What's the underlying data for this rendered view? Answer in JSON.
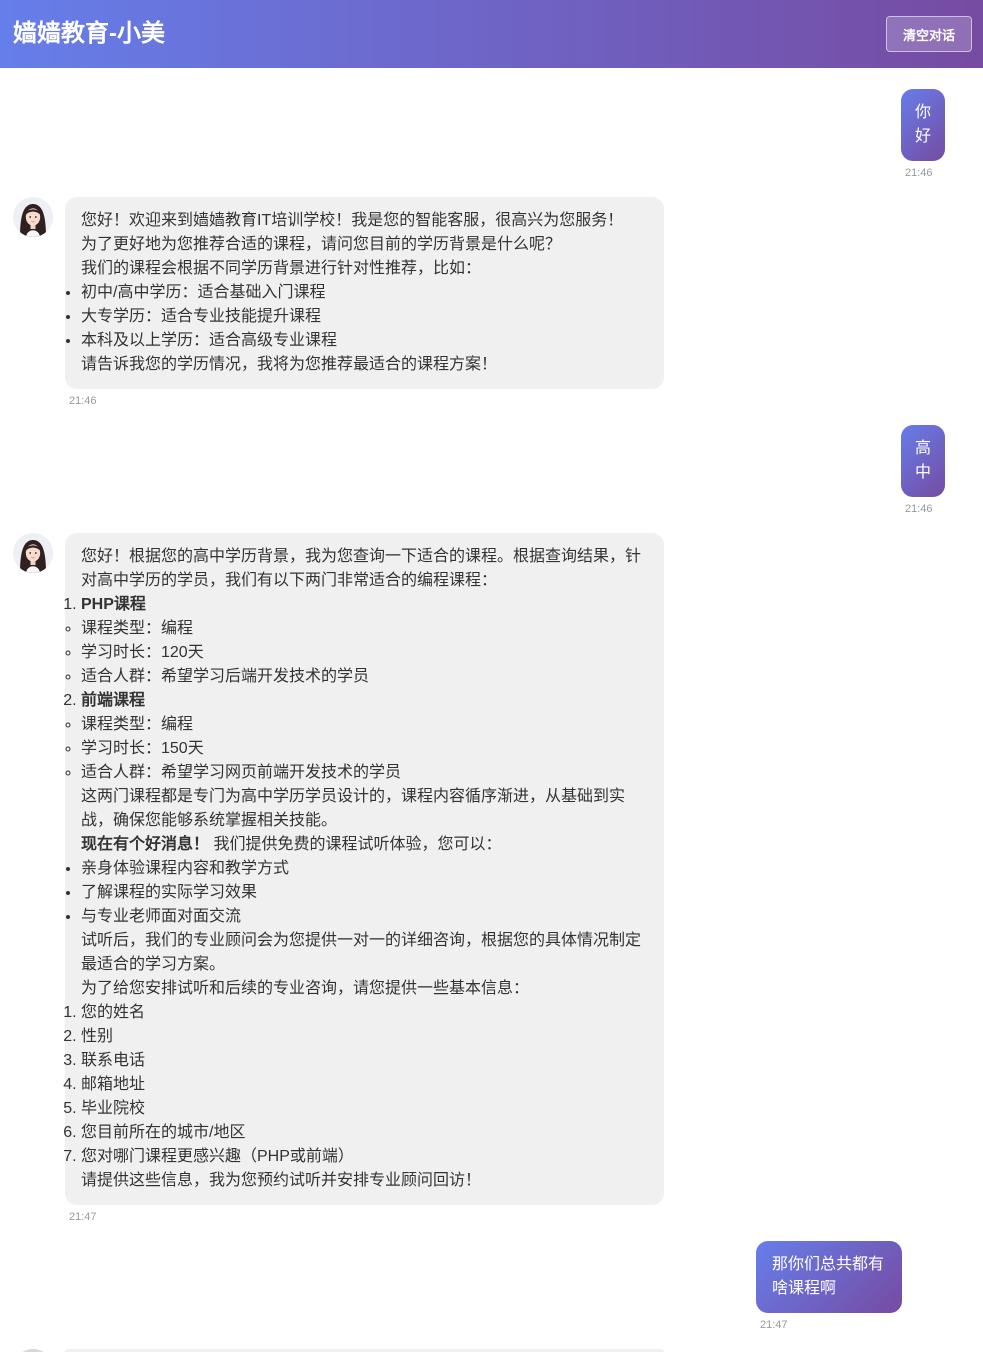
{
  "app": {
    "title": "嫱嫱教育-小美",
    "clear_label": "清空对话"
  },
  "colors": {
    "header_gradient_start": "#667eea",
    "header_gradient_end": "#764ba2",
    "user_bubble_gradient_start": "#667eea",
    "user_bubble_gradient_end": "#764ba2",
    "assistant_bubble": "#f0f0f0",
    "assistant_text": "#333333",
    "time_text": "#999999"
  },
  "messages": [
    {
      "text": "你好",
      "time": "21:46"
    },
    {
      "time": "21:46",
      "intro": [
        "您好！欢迎来到嫱嫱教育IT培训学校！我是您的智能客服，很高兴为您服务！",
        "为了更好地为您推荐合适的课程，请问您目前的学历背景是什么呢？",
        "我们的课程会根据不同学历背景进行针对性推荐，比如："
      ],
      "options": [
        "初中/高中学历：适合基础入门课程",
        "大专学历：适合专业技能提升课程",
        "本科及以上学历：适合高级专业课程"
      ],
      "closing": "请告诉我您的学历情况，我将为您推荐最适合的课程方案！"
    },
    {
      "text": "高中",
      "time": "21:46"
    },
    {
      "time": "21:47",
      "intro": "您好！根据您的高中学历背景，我为您查询一下适合的课程。根据查询结果，针对高中学历的学员，我们有以下两门非常适合的编程课程：",
      "courses": [
        {
          "name": "PHP课程",
          "details": [
            "课程类型：编程",
            "学习时长：120天",
            "适合人群：希望学习后端开发技术的学员"
          ]
        },
        {
          "name": "前端课程",
          "details": [
            "课程类型：编程",
            "学习时长：150天",
            "适合人群：希望学习网页前端开发技术的学员"
          ]
        }
      ],
      "summary": "这两门课程都是专门为高中学历学员设计的，课程内容循序渐进，从基础到实战，确保您能够系统掌握相关技能。",
      "news_bold": "现在有个好消息！",
      "news_text": "我们提供免费的课程试听体验，您可以：",
      "benefits": [
        "亲身体验课程内容和教学方式",
        "了解课程的实际学习效果",
        "与专业老师面对面交流"
      ],
      "after_trial": "试听后，我们的专业顾问会为您提供一对一的详细咨询，根据您的具体情况制定最适合的学习方案。",
      "info_request": "为了给您安排试听和后续的专业咨询，请您提供一些基本信息：",
      "info_fields": [
        "您的姓名",
        "性别",
        "联系电话",
        "邮箱地址",
        "毕业院校",
        "您目前所在的城市/地区",
        "您对哪门课程更感兴趣（PHP或前端）"
      ],
      "closing": "请提供这些信息，我为您预约试听并安排专业顾问回访！"
    },
    {
      "text": "那你们总共都有啥课程啊",
      "time": "21:47"
    }
  ]
}
